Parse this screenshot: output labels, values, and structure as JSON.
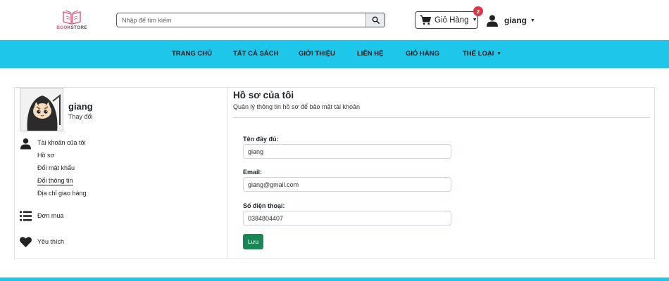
{
  "header": {
    "logo_text_accent": "BOO",
    "logo_text_rest": "KSTORE",
    "search_placeholder": "Nhập để tìm kiếm",
    "cart_label": "Giỏ Hàng",
    "cart_count": "2",
    "username": "giang"
  },
  "nav": {
    "items": [
      "TRANG CHỦ",
      "TẤT CẢ SÁCH",
      "GIỚI THIỆU",
      "LIÊN HỆ",
      "GIỎ HÀNG",
      "THỂ LOẠI"
    ]
  },
  "sidebar": {
    "profile_name": "giang",
    "change_label": "Thay đổi",
    "account_label": "Tài khoản của tôi",
    "account_items": [
      "Hồ sơ",
      "Đổi mật khẩu",
      "Đổi thông tin",
      "Địa chỉ giao hàng"
    ],
    "orders_label": "Đơn mua",
    "favorites_label": "Yêu thích"
  },
  "profile": {
    "title": "Hồ sơ của tôi",
    "subtitle": "Quản lý thông tin hồ sơ để bảo mật tài khoản",
    "fullname_label": "Tên đầy đủ:",
    "fullname_value": "giang",
    "email_label": "Email:",
    "email_value": "giang@gmail.com",
    "phone_label": "Số điện thoại:",
    "phone_value": "0384804407",
    "save_label": "Lưu"
  },
  "colors": {
    "nav_bg": "#1ec6ea",
    "save_button": "#198754",
    "badge": "#dc3545",
    "logo_accent": "#e0527a"
  }
}
